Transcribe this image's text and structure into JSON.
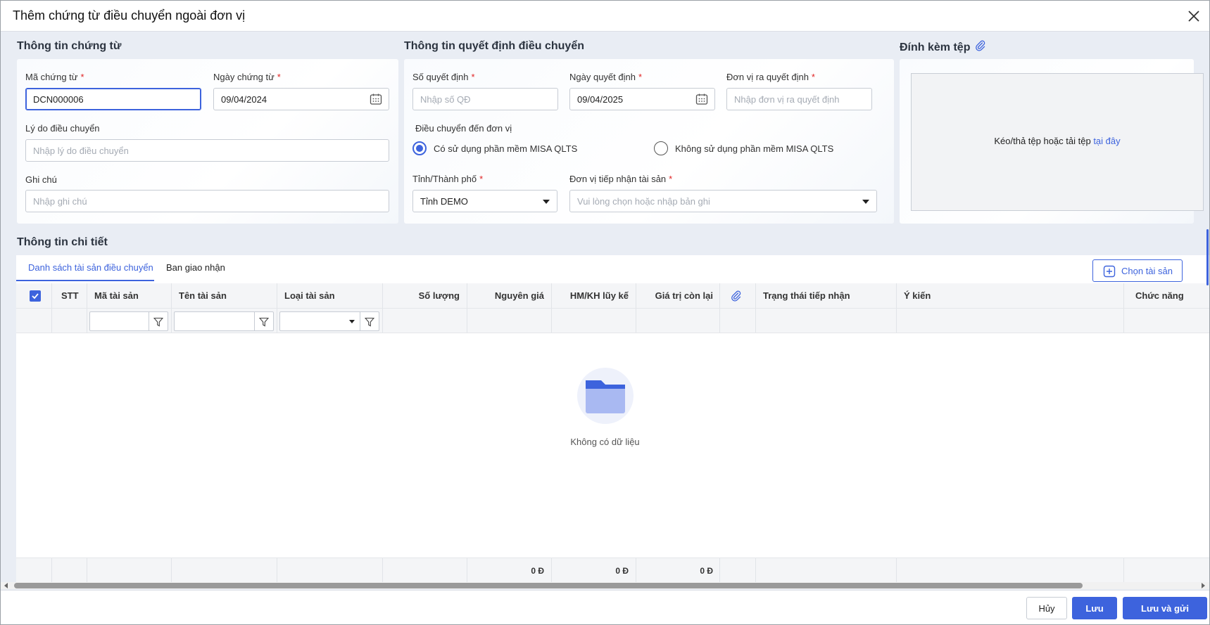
{
  "dialog": {
    "title": "Thêm chứng từ điều chuyển ngoài đơn vị"
  },
  "voucher": {
    "heading": "Thông tin chứng từ",
    "code_label": "Mã chứng từ",
    "code_value": "DCN000006",
    "date_label": "Ngày chứng từ",
    "date_value": "09/04/2024",
    "reason_label": "Lý do điều chuyển",
    "reason_placeholder": "Nhập lý do điều chuyển",
    "note_label": "Ghi chú",
    "note_placeholder": "Nhập ghi chú"
  },
  "decision": {
    "heading": "Thông tin quyết định điều chuyển",
    "number_label": "Số quyết định",
    "number_placeholder": "Nhập số QĐ",
    "date_label": "Ngày quyết định",
    "date_value": "09/04/2025",
    "issuer_label": "Đơn vị ra quyết định",
    "issuer_placeholder": "Nhập đơn vị ra quyết định",
    "transfer_to_label": "Điều chuyển đến đơn vị",
    "radio_yes": "Có sử dụng phần mềm MISA QLTS",
    "radio_no": "Không sử dụng phần mềm MISA QLTS",
    "province_label": "Tỉnh/Thành phố",
    "province_value": "Tỉnh DEMO",
    "receiver_label": "Đơn vị tiếp nhận tài sản",
    "receiver_placeholder": "Vui lòng chọn hoặc nhập bản ghi"
  },
  "attachment": {
    "heading": "Đính kèm tệp",
    "drop_text": "Kéo/thả tệp hoặc tải tệp",
    "drop_link": "tại đây"
  },
  "detail": {
    "heading": "Thông tin chi tiết",
    "tabs": [
      {
        "label": "Danh sách tài sản điều chuyển"
      },
      {
        "label": "Ban giao nhận"
      }
    ],
    "add_button": "Chọn tài sản",
    "columns": {
      "stt": "STT",
      "code": "Mã tài sản",
      "name": "Tên tài sản",
      "type": "Loại tài sản",
      "qty": "Số lượng",
      "cost": "Nguyên giá",
      "depreciation": "HM/KH lũy kế",
      "remaining": "Giá trị còn lại",
      "status": "Trạng thái tiếp nhận",
      "opinion": "Ý kiến",
      "actions": "Chức năng"
    },
    "empty_text": "Không có dữ liệu",
    "totals": {
      "cost": "0 Đ",
      "depreciation": "0 Đ",
      "remaining": "0 Đ"
    }
  },
  "footer": {
    "cancel": "Hủy",
    "save": "Lưu",
    "save_send": "Lưu và gửi"
  },
  "colors": {
    "accent": "#3d63dd",
    "required": "#e02424"
  },
  "icons": [
    "close-icon",
    "calendar-icon",
    "caret-down-icon",
    "paperclip-icon",
    "filter-icon",
    "plus-square-icon",
    "folder-icon",
    "check-icon"
  ]
}
